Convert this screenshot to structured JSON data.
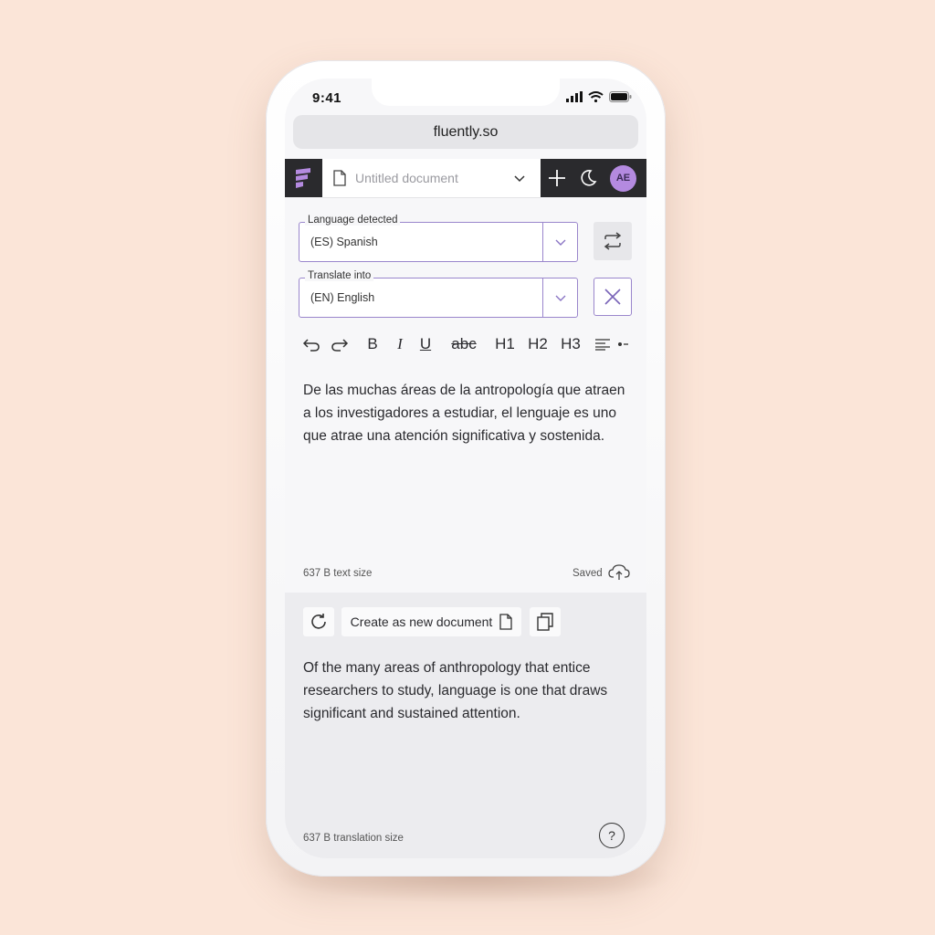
{
  "status_bar": {
    "time": "9:41"
  },
  "browser": {
    "url": "fluently.so"
  },
  "header": {
    "document_title": "Untitled document",
    "avatar_initials": "AE"
  },
  "language_detected": {
    "label": "Language detected",
    "value": "(ES)  Spanish"
  },
  "translate_into": {
    "label": "Translate into",
    "value": "(EN)  English"
  },
  "toolbar": {
    "bold": "B",
    "italic": "I",
    "underline": "U",
    "strikethrough": "abc",
    "h1": "H1",
    "h2": "H2",
    "h3": "H3"
  },
  "source": {
    "text": "De las muchas áreas de la antropología que atraen a los investigadores a estudiar, el lenguaje es uno que atrae una atención significativa y sostenida.",
    "size_label": "637 B text size",
    "saved_label": "Saved"
  },
  "translation": {
    "create_button_label": "Create as new document",
    "text": "Of the many areas of anthropology that entice researchers to study, language is one that draws significant and sustained attention.",
    "size_label": "637 B translation size",
    "help_label": "?"
  },
  "colors": {
    "background": "#fbe5d8",
    "accent_purple": "#9a86cc",
    "avatar": "#b48ae0",
    "dark_bar": "#2a2a2d"
  }
}
